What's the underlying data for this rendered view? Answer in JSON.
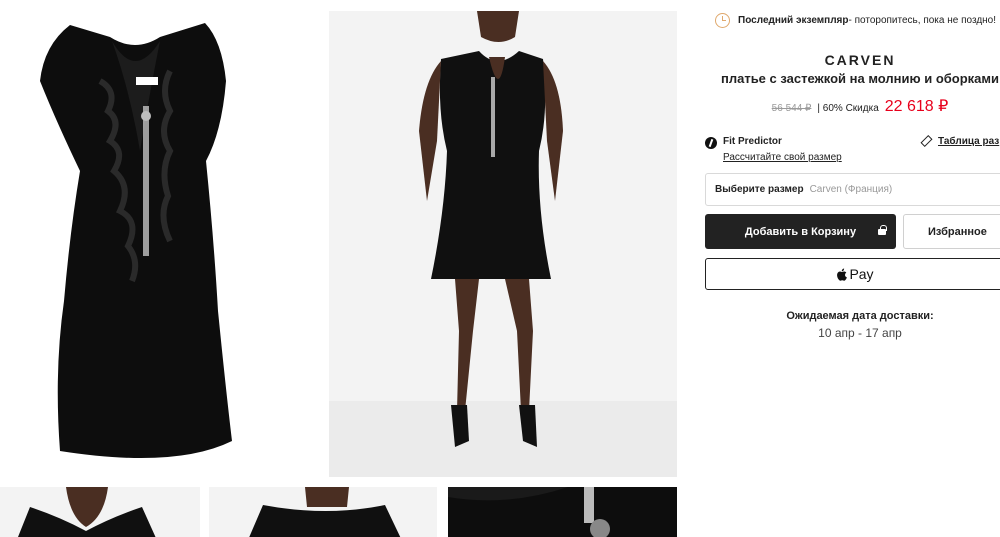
{
  "notice": {
    "strong": "Последний экземпляр",
    "text": " - поторопитесь, пока не поздно!",
    "icon": "clock-icon",
    "icon_color": "#e0a96d"
  },
  "product": {
    "brand": "CARVEN",
    "name": "платье с застежкой на молнию и оборками",
    "old_price": "56 544 ₽",
    "discount": "| 60% Скидка",
    "new_price": "22 618 ₽",
    "price_color": "#e8001c"
  },
  "fit": {
    "title": "Fit Predictor",
    "link": "Рассчитайте свой размер",
    "size_table": "Таблица раз"
  },
  "size_select": {
    "label": "Выберите размер",
    "value": "Carven (Франция)"
  },
  "actions": {
    "cart": "Добавить в Корзину",
    "wishlist": "Избранное",
    "pay": "Pay"
  },
  "delivery": {
    "title": "Ожидаемая дата доставки:",
    "dates": "10 апр - 17 апр"
  }
}
